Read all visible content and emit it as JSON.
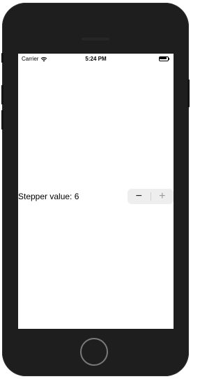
{
  "status_bar": {
    "carrier": "Carrier",
    "time": "5:24 PM",
    "wifi_icon": "wifi-icon",
    "battery_icon": "battery-full-icon"
  },
  "stepper": {
    "label": "Stepper value: 6",
    "value": 6,
    "decrement_glyph": "−",
    "increment_glyph": "+",
    "decrement_icon": "minus-icon",
    "increment_icon": "plus-icon"
  },
  "device": {
    "home_button_icon": "home-button"
  }
}
